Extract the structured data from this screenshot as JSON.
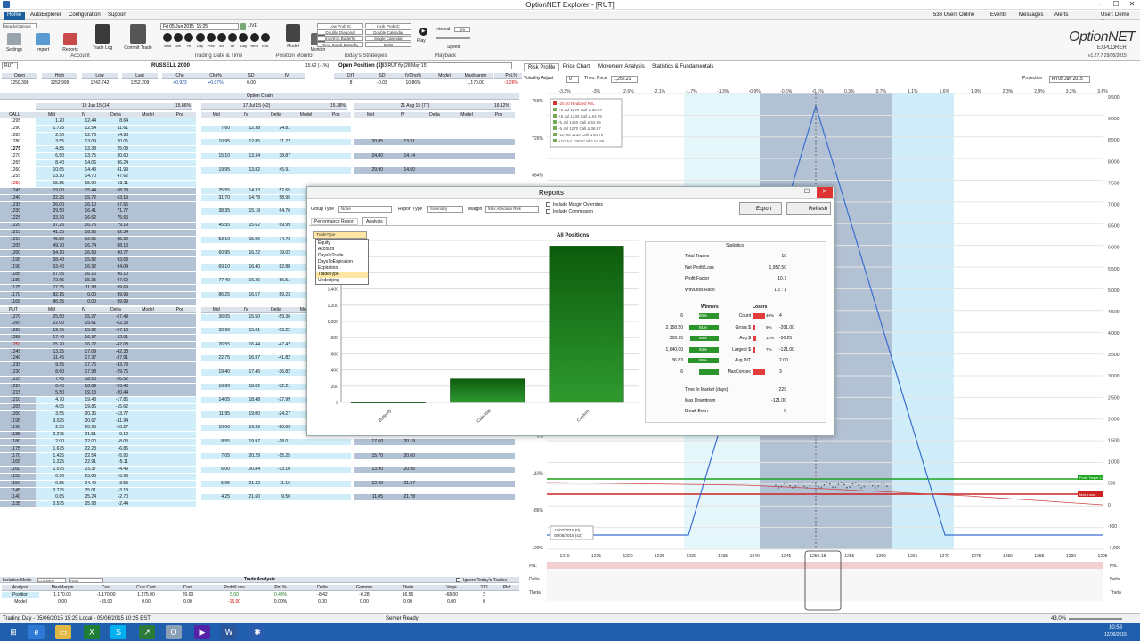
{
  "window": {
    "title": "OptionNET Explorer - [RUT]",
    "min": "–",
    "max": "☐",
    "close": "✕"
  },
  "menu": [
    "Home",
    "AutoExplorer",
    "Configuration",
    "Support"
  ],
  "top_right": {
    "users": "536 Users Online",
    "events": "Events",
    "messages": "Messages",
    "alerts": "Alerts",
    "user": "User: Demo User"
  },
  "logo": {
    "line1": "OptionNET",
    "line2": "EXPLORER",
    "version": "v1.27.7  29/05/2015"
  },
  "toolbar": {
    "strategy": "Steady/Options",
    "settings": "Settings",
    "import": "Import",
    "reports": "Reports",
    "trade_log": "Trade Log",
    "commit": "Commit Trade",
    "group_account": "Account",
    "date": "Fri 05 Jun 2015  15:25",
    "live": "LIVE",
    "group_trading": "Trading Date & Time",
    "model": "Model",
    "monitor": "Monitor",
    "group_position": "Position Monitor",
    "strategies": [
      "Low Prob IC",
      "High Prob IC",
      "Double Diagonal",
      "Double Calendar",
      "Iron/Iron Butterfly",
      "Single Calendar",
      "Time Bomb Butterfly",
      "BWB"
    ],
    "group_strat": "Today's Strategies",
    "interval": "Interval",
    "interval_val": "5m",
    "play": "Play",
    "speed": "Speed",
    "group_playback": "Playback",
    "nav": [
      "Start",
      "5m",
      "Hr",
      "Day",
      "Prev",
      "5m",
      "Hr",
      "Day",
      "Next",
      "End"
    ]
  },
  "underlying": {
    "symbol": "RUT",
    "name": "RUSSELL 2000",
    "chg_text": "15.62 (-1%)",
    "headers": [
      "Open",
      "High",
      "Low",
      "Last",
      "Chg",
      "Chg%",
      "SD",
      "IV"
    ],
    "values": [
      "1250.398",
      "1252.999",
      "1242.742",
      "1252.209",
      "+0.923",
      "+0.07%",
      "0.00",
      ""
    ]
  },
  "open_position": {
    "title": "Open Position (1)",
    "acct": "B3 RUT fly (28 May 15)",
    "headers": [
      "DIT",
      "SD",
      "IVChg%",
      "Model",
      "MaxMargin",
      "PnL%"
    ],
    "values": [
      "8",
      "-0.03",
      "10.86%",
      "",
      "1,170.00",
      "-1.26%"
    ]
  },
  "option_chain": {
    "title": "Option Chain",
    "expiries": [
      {
        "label": "19 Jun 15 (14)",
        "iv": "15.86%"
      },
      {
        "label": "17 Jul 15 (42)",
        "iv": "15.38%"
      },
      {
        "label": "21 Aug 15 (77)",
        "iv": "16.12%"
      }
    ],
    "col_headers": [
      "Mid",
      "IV",
      "Delta",
      "Model",
      "Pos"
    ],
    "call_label": "CALL",
    "put_label": "PUT",
    "calls": [
      [
        "1295",
        "1.20",
        "12.44",
        "8.64",
        "",
        "",
        "",
        "",
        ""
      ],
      [
        "1290",
        "1.725",
        "12.54",
        "11.61",
        "7.60",
        "12.38",
        "24.81",
        "",
        ""
      ],
      [
        "1285",
        "2.50",
        "12.78",
        "14.98",
        "",
        "",
        "",
        "",
        ""
      ],
      [
        "1280",
        "3.55",
        "13.09",
        "20.05",
        "10.95",
        "12.85",
        "31.72",
        "20.05",
        "13.31"
      ],
      [
        "1275",
        "4.85",
        "13.38",
        "25.08",
        "",
        "",
        "",
        "",
        ""
      ],
      [
        "1270",
        "6.50",
        "13.75",
        "30.60",
        "15.10",
        "13.34",
        "38.87",
        "24.80",
        "14.14"
      ],
      [
        "1265",
        "8.40",
        "14.06",
        "36.24",
        "",
        "",
        "",
        "",
        ""
      ],
      [
        "1260",
        "10.65",
        "14.43",
        "41.99",
        "19.95",
        "13.82",
        "45.91",
        "29.90",
        "14.50"
      ],
      [
        "1255",
        "13.10",
        "14.70",
        "47.62",
        "",
        "",
        "",
        "",
        ""
      ],
      [
        "1250",
        "15.85",
        "15.00",
        "53.11",
        "",
        "",
        "",
        "",
        ""
      ],
      [
        "1245",
        "19.00",
        "15.44",
        "58.29",
        "25.55",
        "14.33",
        "52.65",
        "",
        ""
      ],
      [
        "1240",
        "22.25",
        "15.72",
        "63.19",
        "31.70",
        "14.78",
        "58.95",
        "",
        ""
      ],
      [
        "1235",
        "26.00",
        "16.10",
        "67.65",
        "",
        "",
        "",
        "",
        ""
      ],
      [
        "1230",
        "29.50",
        "16.41",
        "71.77",
        "38.35",
        "15.19",
        "64.76",
        "",
        ""
      ],
      [
        "1225",
        "33.30",
        "16.62",
        "75.63",
        "",
        "",
        "",
        "",
        ""
      ],
      [
        "1220",
        "37.25",
        "16.75",
        "79.19",
        "45.55",
        "15.62",
        "69.99",
        "",
        ""
      ],
      [
        "1215",
        "41.35",
        "16.95",
        "82.34",
        "",
        "",
        "",
        "",
        ""
      ],
      [
        "1210",
        "45.50",
        "16.95",
        "85.30",
        "53.10",
        "15.96",
        "74.72",
        "",
        ""
      ],
      [
        "1205",
        "49.70",
        "16.74",
        "88.13",
        "",
        "",
        "",
        "",
        ""
      ],
      [
        "1200",
        "54.10",
        "16.63",
        "90.77",
        "60.95",
        "16.22",
        "79.02",
        "",
        ""
      ],
      [
        "1195",
        "58.40",
        "15.82",
        "93.68",
        "",
        "",
        "",
        "",
        ""
      ],
      [
        "1190",
        "63.40",
        "16.92",
        "94.04",
        "69.10",
        "16.40",
        "82.88",
        "",
        ""
      ],
      [
        "1185",
        "67.95",
        "16.16",
        "96.10",
        "",
        "",
        "",
        "",
        ""
      ],
      [
        "1180",
        "72.65",
        "15.35",
        "97.69",
        "77.40",
        "16.36",
        "86.51",
        "",
        ""
      ],
      [
        "1175",
        "77.35",
        "11.98",
        "99.69",
        "",
        "",
        "",
        "",
        ""
      ],
      [
        "1170",
        "82.15",
        "0.00",
        "99.99",
        "86.25",
        "16.57",
        "89.23",
        "",
        ""
      ],
      [
        "1165",
        "86.95",
        "0.00",
        "99.99",
        "",
        "",
        "",
        "",
        ""
      ]
    ],
    "puts": [
      [
        "1270",
        "25.50",
        "15.27",
        "-67.49",
        "36.05",
        "15.50",
        "-59.36",
        "",
        ""
      ],
      [
        "1265",
        "22.00",
        "15.61",
        "-62.33",
        "",
        "",
        "",
        "",
        ""
      ],
      [
        "1260",
        "19.75",
        "15.92",
        "-57.16",
        "30.90",
        "15.61",
        "-53.22",
        "",
        ""
      ],
      [
        "1255",
        "17.40",
        "16.37",
        "-52.01",
        "",
        "",
        "",
        "",
        ""
      ],
      [
        "1250",
        "15.20",
        "16.72",
        "-47.08",
        "26.55",
        "16.44",
        "-47.42",
        "",
        ""
      ],
      [
        "1245",
        "13.25",
        "17.09",
        "-42.38",
        "",
        "",
        "",
        "",
        ""
      ],
      [
        "1240",
        "11.45",
        "17.37",
        "-37.91",
        "22.75",
        "16.97",
        "-41.82",
        "",
        ""
      ],
      [
        "1235",
        "9.95",
        "17.76",
        "-33.79",
        "",
        "",
        "",
        "",
        ""
      ],
      [
        "1230",
        "8.60",
        "17.98",
        "-29.76",
        "19.40",
        "17.46",
        "-36.82",
        "",
        ""
      ],
      [
        "1225",
        "7.45",
        "18.50",
        "-26.52",
        "",
        "",
        "",
        "",
        ""
      ],
      [
        "1220",
        "6.45",
        "18.89",
        "-23.40",
        "16.60",
        "18.02",
        "-32.21",
        "",
        ""
      ],
      [
        "1215",
        "5.50",
        "19.13",
        "-20.44",
        "",
        "",
        "",
        "",
        ""
      ],
      [
        "1210",
        "4.70",
        "19.48",
        "-17.86",
        "14.05",
        "18.48",
        "-27.99",
        "24.85",
        "19.04"
      ],
      [
        "1205",
        "4.05",
        "19.86",
        "-15.62",
        "",
        "",
        "",
        "",
        ""
      ],
      [
        "1200",
        "3.55",
        "20.36",
        "-13.77",
        "11.95",
        "19.00",
        "-24.27",
        "22.20",
        "19.44"
      ],
      [
        "1195",
        "3.025",
        "20.67",
        "-11.94",
        "",
        "",
        "",
        "",
        ""
      ],
      [
        "1190",
        "2.55",
        "20.93",
        "-10.27",
        "10.00",
        "19.39",
        "-20.83",
        "19.90",
        "19.93"
      ],
      [
        "1185",
        "2.275",
        "21.51",
        "-9.12",
        "",
        "",
        "",
        "",
        ""
      ],
      [
        "1180",
        "2.00",
        "22.00",
        "-8.03",
        "8.55",
        "19.97",
        "-18.01",
        "17.60",
        "20.19"
      ],
      [
        "1175",
        "1.675",
        "22.23",
        "-6.86",
        "",
        "",
        "",
        "",
        ""
      ],
      [
        "1170",
        "1.425",
        "22.54",
        "-5.90",
        "7.05",
        "20.29",
        "-15.25",
        "15.70",
        "20.60"
      ],
      [
        "1165",
        "1.225",
        "22.91",
        "-5.11",
        "",
        "",
        "",
        "",
        ""
      ],
      [
        "1160",
        "1.075",
        "23.37",
        "-4.49",
        "6.00",
        "20.84",
        "-13.10",
        "13.90",
        "20.95"
      ],
      [
        "1155",
        "0.90",
        "23.86",
        "-3.96",
        "",
        "",
        "",
        "",
        ""
      ],
      [
        "1150",
        "0.85",
        "24.40",
        "-3.53",
        "5.05",
        "21.32",
        "-11.16",
        "12.40",
        "21.37"
      ],
      [
        "1145",
        "0.775",
        "25.01",
        "-3.18",
        "",
        "",
        "",
        "",
        ""
      ],
      [
        "1140",
        "0.65",
        "25.24",
        "-2.70",
        "4.25",
        "21.60",
        "-9.50",
        "11.05",
        "21.78"
      ],
      [
        "1135",
        "0.575",
        "25.98",
        "-2.44",
        "",
        "",
        "",
        "",
        ""
      ]
    ]
  },
  "trade_analysis": {
    "title": "Trade Analysis",
    "isolation": "Isolation Mode",
    "combine": "Combine",
    "auto": "Auto",
    "ignore": "Ignore Today's Trades",
    "headers": [
      "Analysis",
      "MaxMargin",
      "Cost",
      "Curr Cost",
      "Com",
      "Profit/Loss",
      "PnL%",
      "Delta",
      "Gamma",
      "Theta",
      "Vega",
      "T/D",
      "Plot"
    ],
    "rows": [
      [
        "Position",
        "1,170.00",
        "-1,170.00",
        "1,175.00",
        "20.00",
        "5.00",
        "0.43%",
        "-8.42",
        "-0.28",
        "16.56",
        "-68.00",
        "2",
        ""
      ],
      [
        "Model",
        "0.00",
        "-15.00",
        "0.00",
        "0.00",
        "-15.00",
        "0.00%",
        "0.00",
        "0.00",
        "0.00",
        "0.00",
        "0",
        ""
      ]
    ]
  },
  "risk": {
    "tabs": [
      "Risk Profile",
      "Price Chart",
      "Movement Analysis",
      "Statistics & Fundamentals"
    ],
    "vol_adjust": "Volatility Adjust",
    "vol_val": "0",
    "theo": "Theo. Price",
    "theo_val": "1,252.21",
    "projection": "Projection",
    "proj_date": "Fri 05 Jun 2015",
    "top_axis": [
      "-3.3%",
      "-3%",
      "-2.6%",
      "-2.1%",
      "-1.7%",
      "-1.3%",
      "-0.9%",
      "-0.6%",
      "-0.1%",
      "0.3%",
      "0.7%",
      "1.1%",
      "1.6%",
      "1.9%",
      "2.3%",
      "2.8%",
      "3.2%",
      "3.6%"
    ],
    "left_axis": [
      "769%",
      "726%",
      "684%",
      "641%",
      "598%",
      "556%",
      "513%",
      "470%",
      "43%",
      "0%",
      "-43%",
      "-86%",
      "-120%"
    ],
    "right_axis": [
      "9,500",
      "9,000",
      "8,500",
      "8,000",
      "7,500",
      "7,000",
      "6,500",
      "6,000",
      "5,500",
      "5,000",
      "4,500",
      "4,000",
      "3,500",
      "3,000",
      "2,500",
      "2,000",
      "1,500",
      "1,000",
      "500",
      "0",
      "-500",
      "-1,000"
    ],
    "bottom_axis": [
      "1210",
      "1215",
      "1220",
      "1225",
      "1230",
      "1235",
      "1240",
      "1245",
      "1250.18",
      "1255",
      "1260",
      "1265",
      "1270",
      "1275",
      "1280",
      "1285",
      "1290",
      "1295"
    ],
    "legend": [
      "-20.00 Realized PnL",
      "+5 Jul 1270 Call Δ 38.87",
      "+8 Jul 1230 Call Δ 64.76",
      "-5 Jul 1250 Call Δ 52.65",
      "-5 Jul 1270 Call Δ 38.87",
      "-10 Jul 1230 Call Δ 64.76",
      "+10 Jul 1250 Call Δ 52.65"
    ],
    "legend2": [
      "17/07/2015 (0)",
      "05/06/2015 (42)"
    ],
    "profit_target": "Profit Target 175",
    "loss_label": "Max Loss",
    "rows_labels": [
      "PnL",
      "Delta",
      "Theta"
    ]
  },
  "dialog": {
    "title": "Reports",
    "group_type": "Group Type",
    "group_val": "None",
    "report_type": "Report Type",
    "report_val": "Summary",
    "margin": "Margin",
    "margin_val": "Max Absolute Risk",
    "include_margin": "Include Margin Overrides",
    "include_comm": "Include Commission",
    "export": "Export",
    "refresh": "Refresh",
    "tabs": [
      "Performance Report",
      "Analysis"
    ],
    "dropdown_val": "TradeType",
    "dropdown_items": [
      "Equity",
      "Account",
      "DaysInTrade",
      "DaysToExpiration",
      "Expiration",
      "TradeType",
      "Underlying"
    ],
    "chart_title": "All Positions",
    "stats_title": "Statistics",
    "stats": [
      [
        "Total Trades",
        "10"
      ],
      [
        "Net Profit/Loss",
        "1,957.50"
      ],
      [
        "Profit Factor",
        "10.7"
      ],
      [
        "Win/Loss Ratio",
        "1.5 : 1"
      ]
    ],
    "wl_headers": [
      "Winners",
      "Losers"
    ],
    "wl_rows": [
      [
        "6",
        "60%",
        "Count",
        "40%",
        "4"
      ],
      [
        "2,158.50",
        "91%",
        "Gross $",
        "9%",
        "-201.00"
      ],
      [
        "359.75",
        "88%",
        "Avg $",
        "12%",
        "-50.25"
      ],
      [
        "1,640.00",
        "93%",
        "Largest $",
        "7%",
        "-121.00"
      ],
      [
        "36.83",
        "95%",
        "Avg DIT",
        "",
        "2.00"
      ],
      [
        "6",
        "",
        "MaxConsec",
        "",
        "3"
      ]
    ],
    "stats2": [
      [
        "Time In Market (days)",
        "229"
      ],
      [
        "Max Drawdown",
        "-121.00"
      ],
      [
        "Break Even",
        "0"
      ]
    ]
  },
  "chart_data": {
    "type": "bar",
    "title": "All Positions",
    "categories": [
      "Butterfly",
      "Calendar",
      "Custom"
    ],
    "values": [
      0,
      290,
      1930
    ],
    "ylim": [
      0,
      2000
    ],
    "yticks": [
      "2,000",
      "1,800",
      "1,600",
      "1,400",
      "1,200",
      "1,000",
      "800",
      "600",
      "400",
      "200",
      "0"
    ],
    "xlabel": "",
    "ylabel": ""
  },
  "status": {
    "left": "Trading Day - 05/06/2015 15:25 Local - 05/06/2015 10:25 EST",
    "center": "Server Ready",
    "zoom": "43.0%"
  },
  "taskbar": {
    "time": "10:58",
    "date": "12/06/2015"
  },
  "colors": {
    "accent": "#1b5e9e",
    "call_band": "#cfeef9",
    "grey_band": "#b3c1d4",
    "bar": "#1a7a1a",
    "taskbar": "#1f5fae"
  }
}
